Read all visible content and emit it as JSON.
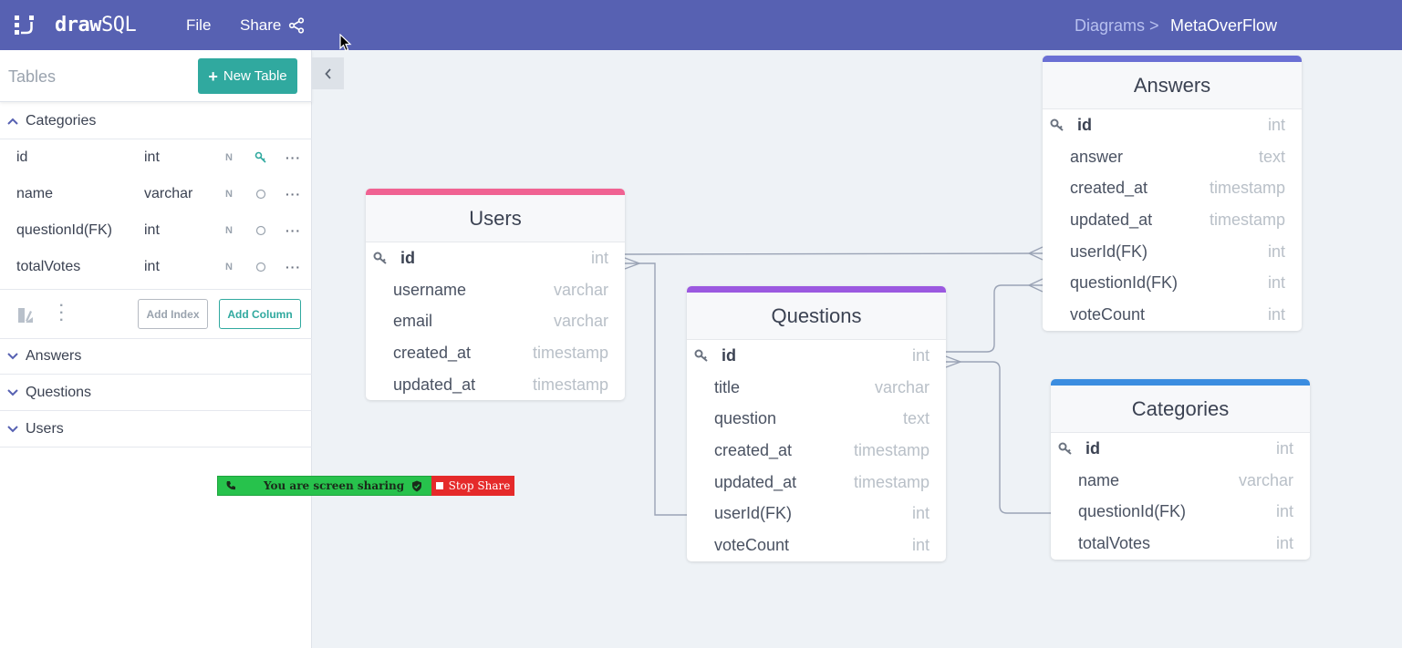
{
  "header": {
    "logo": "drawSQL",
    "logo_bold": "draw",
    "logo_light": "SQL",
    "menu_file": "File",
    "menu_share": "Share",
    "breadcrumb_parent": "Diagrams >",
    "breadcrumb_current": "MetaOverFlow",
    "color": "#5761b2"
  },
  "sidebar": {
    "title": "Tables",
    "new_table_label": "New Table",
    "expanded_table": "Categories",
    "columns": [
      {
        "name": "id",
        "type": "int",
        "nullable": "N",
        "key": "primary"
      },
      {
        "name": "name",
        "type": "varchar",
        "nullable": "N",
        "key": "none"
      },
      {
        "name": "questionId(FK)",
        "type": "int",
        "nullable": "N",
        "key": "none"
      },
      {
        "name": "totalVotes",
        "type": "int",
        "nullable": "N",
        "key": "none"
      }
    ],
    "add_index_label": "Add Index",
    "add_column_label": "Add Column",
    "collapsed_tables": [
      "Answers",
      "Questions",
      "Users"
    ]
  },
  "screen_share": {
    "status_text": "You are screen sharing",
    "stop_label": "Stop Share"
  },
  "tables": {
    "users": {
      "name": "Users",
      "accent": "#f06292",
      "columns": [
        {
          "name": "id",
          "type": "int"
        },
        {
          "name": "username",
          "type": "varchar"
        },
        {
          "name": "email",
          "type": "varchar"
        },
        {
          "name": "created_at",
          "type": "timestamp"
        },
        {
          "name": "updated_at",
          "type": "timestamp"
        }
      ]
    },
    "questions": {
      "name": "Questions",
      "accent": "#9b59e0",
      "columns": [
        {
          "name": "id",
          "type": "int"
        },
        {
          "name": "title",
          "type": "varchar"
        },
        {
          "name": "question",
          "type": "text"
        },
        {
          "name": "created_at",
          "type": "timestamp"
        },
        {
          "name": "updated_at",
          "type": "timestamp"
        },
        {
          "name": "userId(FK)",
          "type": "int"
        },
        {
          "name": "voteCount",
          "type": "int"
        }
      ]
    },
    "answers": {
      "name": "Answers",
      "accent": "#6a6fd4",
      "columns": [
        {
          "name": "id",
          "type": "int"
        },
        {
          "name": "answer",
          "type": "text"
        },
        {
          "name": "created_at",
          "type": "timestamp"
        },
        {
          "name": "updated_at",
          "type": "timestamp"
        },
        {
          "name": "userId(FK)",
          "type": "int"
        },
        {
          "name": "questionId(FK)",
          "type": "int"
        },
        {
          "name": "voteCount",
          "type": "int"
        }
      ]
    },
    "categories": {
      "name": "Categories",
      "accent": "#3b8de0",
      "columns": [
        {
          "name": "id",
          "type": "int"
        },
        {
          "name": "name",
          "type": "varchar"
        },
        {
          "name": "questionId(FK)",
          "type": "int"
        },
        {
          "name": "totalVotes",
          "type": "int"
        }
      ]
    }
  },
  "icons": {
    "primary_key": "key-icon",
    "share": "share-icon",
    "collapse": "chevron-left-icon"
  }
}
